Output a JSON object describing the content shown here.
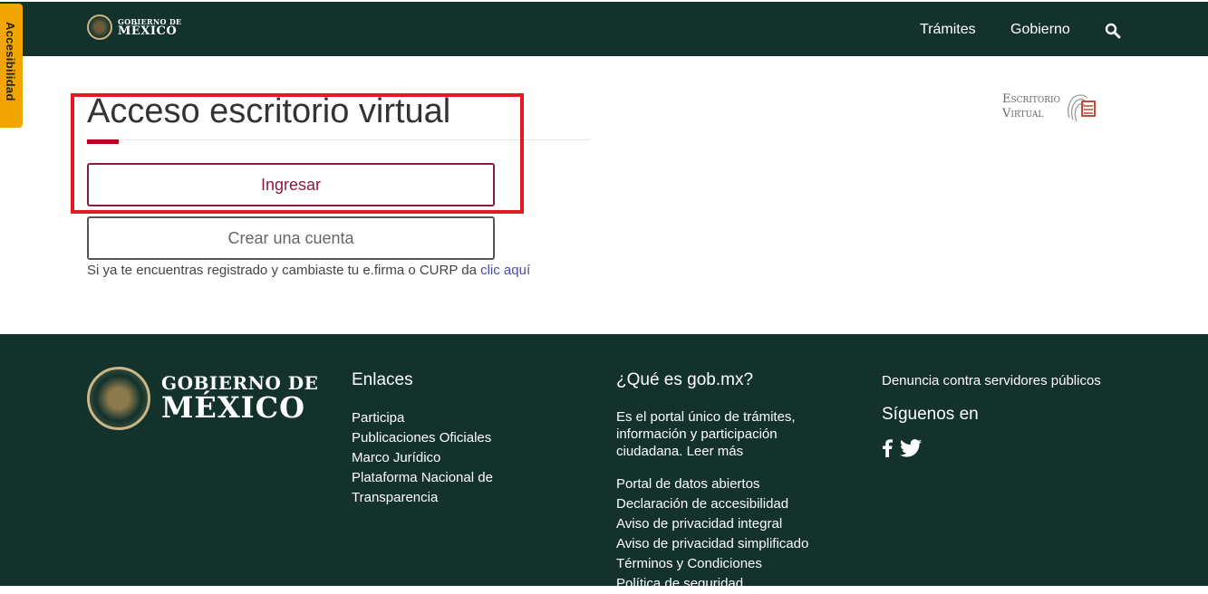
{
  "header": {
    "logo_line1": "GOBIERNO DE",
    "logo_line2": "MÉXICO",
    "nav": [
      "Trámites",
      "Gobierno"
    ],
    "search_icon": "search-icon"
  },
  "accessibility_tab": "Accesibilidad",
  "main": {
    "title": "Acceso escritorio virtual",
    "login_button": "Ingresar",
    "create_account_button": "Crear una cuenta",
    "help_text": "Si ya te encuentras registrado y cambiaste tu e.firma o CURP da ",
    "help_link": "clic aquí",
    "ev_logo_line1": "Escritorio",
    "ev_logo_line2": "Virtual"
  },
  "footer": {
    "logo_line1": "GOBIERNO DE",
    "logo_line2": "MÉXICO",
    "links_title": "Enlaces",
    "links": [
      "Participa",
      "Publicaciones Oficiales",
      "Marco Jurídico",
      "Plataforma Nacional de Transparencia"
    ],
    "what_title": "¿Qué es gob.mx?",
    "what_text": "Es el portal único de trámites, información y participación ciudadana. Leer más",
    "what_links": [
      "Portal de datos abiertos",
      "Declaración de accesibilidad",
      "Aviso de privacidad integral",
      "Aviso de privacidad simplificado",
      "Términos y Condiciones",
      "Política de seguridad"
    ],
    "report_link": "Denuncia contra servidores públicos",
    "social_title": "Síguenos en",
    "social_icons": [
      "facebook-icon",
      "twitter-icon"
    ]
  },
  "colors": {
    "header_bg": "#13322b",
    "accent_red": "#b8001f",
    "button_border": "#8b1a41",
    "access_tab": "#f0a500",
    "highlight": "#e01b24"
  }
}
